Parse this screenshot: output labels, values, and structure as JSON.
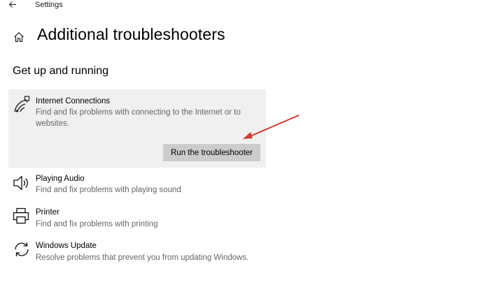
{
  "window": {
    "title": "Settings"
  },
  "header": {
    "page_title": "Additional troubleshooters"
  },
  "section": {
    "title": "Get up and running"
  },
  "troubleshooters": [
    {
      "name": "Internet Connections",
      "description": "Find and fix problems with connecting to the Internet or to websites.",
      "icon": "wifi-icon",
      "selected": true
    },
    {
      "name": "Playing Audio",
      "description": "Find and fix problems with playing sound",
      "icon": "speaker-icon"
    },
    {
      "name": "Printer",
      "description": "Find and fix problems with printing",
      "icon": "printer-icon"
    },
    {
      "name": "Windows Update",
      "description": "Resolve problems that prevent you from updating Windows.",
      "icon": "refresh-icon"
    }
  ],
  "actions": {
    "run_label": "Run the troubleshooter"
  },
  "colors": {
    "selected_bg": "#f0f0f0",
    "button_bg": "#cccccc",
    "annotation_arrow": "#d03a30",
    "secondary_text": "#666666"
  }
}
